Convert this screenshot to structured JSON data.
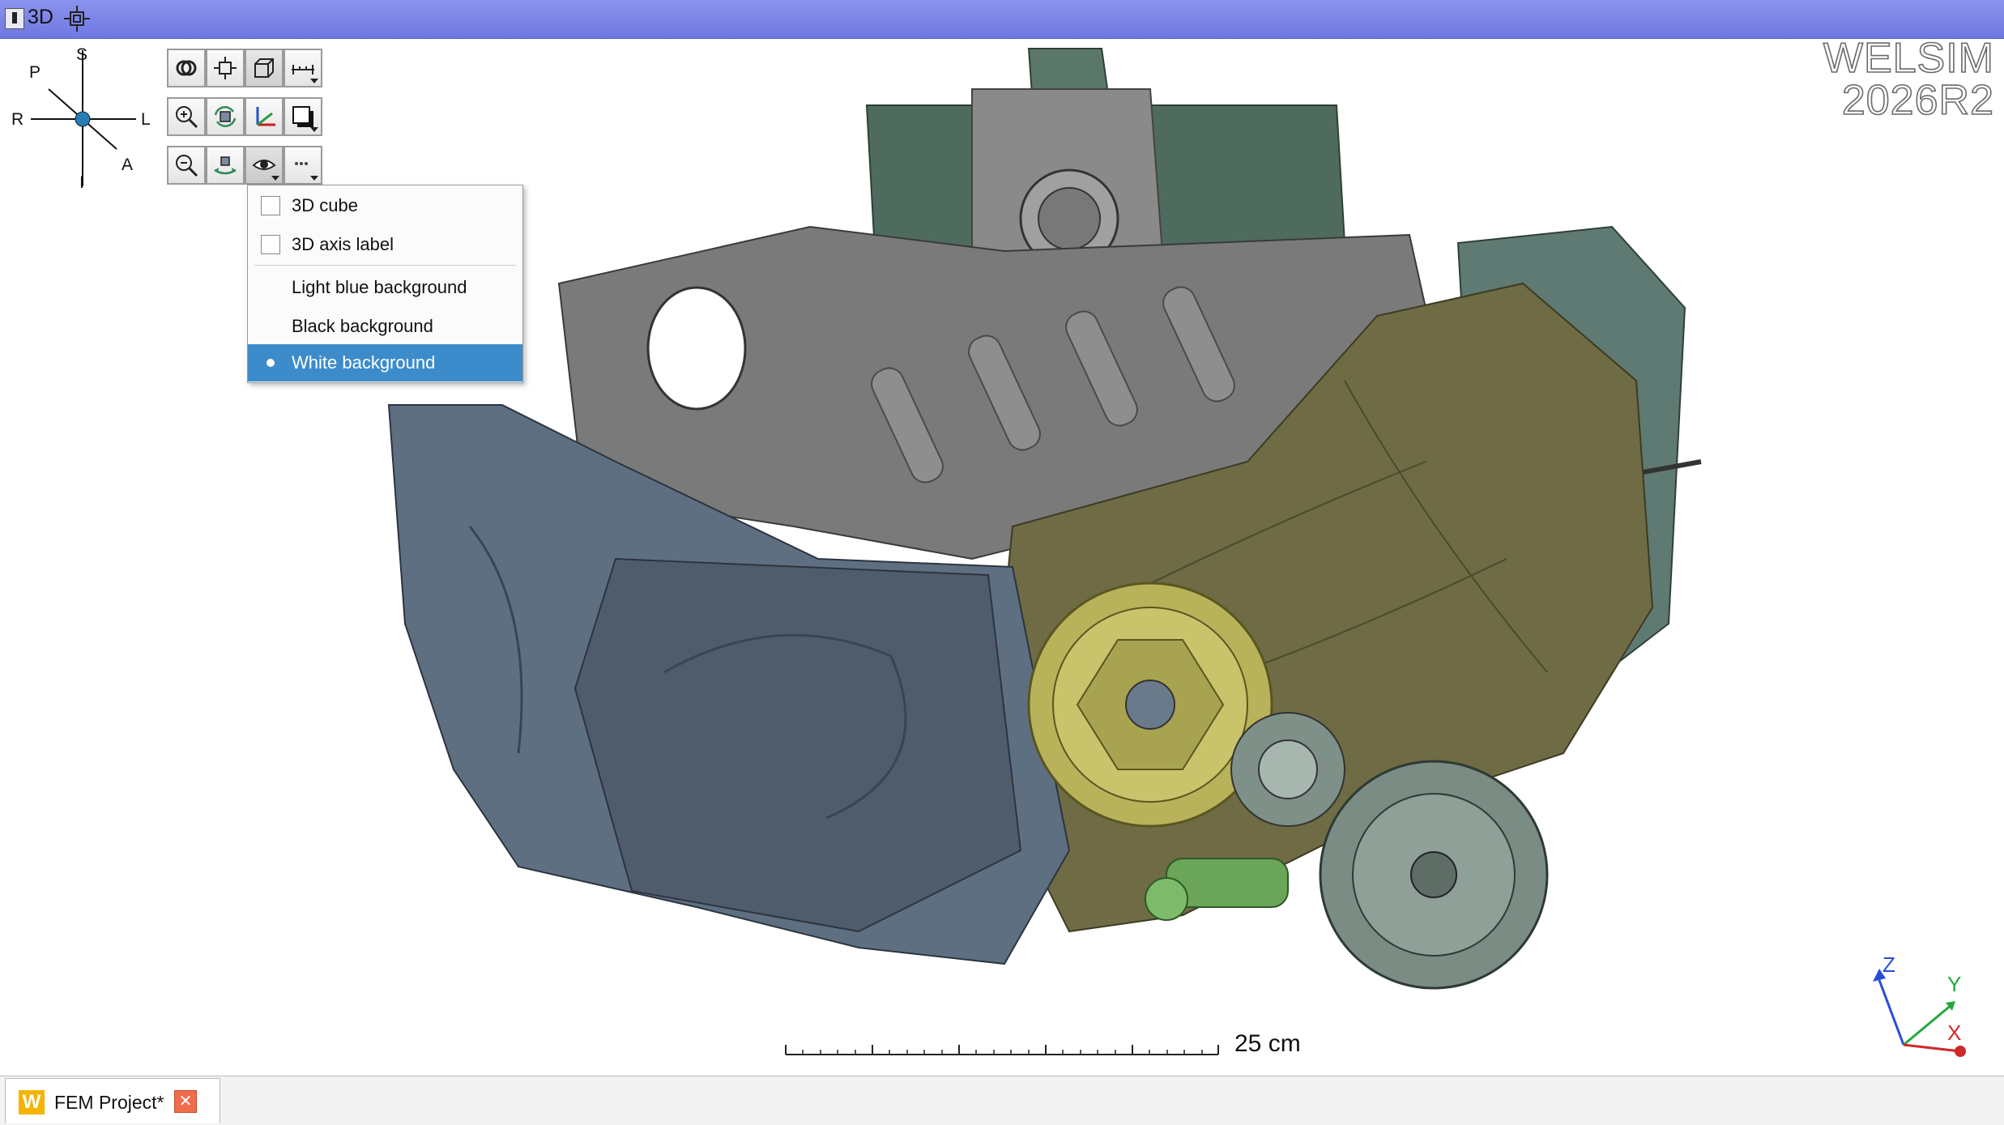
{
  "window": {
    "title": "3D"
  },
  "orientation": {
    "top": "S",
    "upper_left": "P",
    "left": "R",
    "right": "L",
    "lower_right": "A",
    "bottom": "I"
  },
  "toolbar": {
    "rows": [
      [
        "link-icon",
        "fit-view-icon",
        "cube-view-icon",
        "ruler-icon"
      ],
      [
        "zoom-in-icon",
        "rotate-view-icon",
        "axes-icon",
        "shadow-icon"
      ],
      [
        "zoom-out-icon",
        "pan-icon",
        "eye-icon",
        "more-icon"
      ]
    ]
  },
  "display_menu": {
    "items": [
      {
        "label": "3D cube",
        "type": "checkbox",
        "checked": false
      },
      {
        "label": "3D axis label",
        "type": "checkbox",
        "checked": false
      },
      {
        "label": "Light blue background",
        "type": "radio",
        "selected": false
      },
      {
        "label": "Black background",
        "type": "radio",
        "selected": false
      },
      {
        "label": "White background",
        "type": "radio",
        "selected": true
      }
    ]
  },
  "branding": {
    "line1": "WELSIM",
    "line2": "2026R2"
  },
  "scale": {
    "label": "25 cm"
  },
  "axis_triad": {
    "z": "Z",
    "y": "Y",
    "x": "X"
  },
  "tabs": [
    {
      "icon": "W",
      "label": "FEM Project*",
      "close": "✕"
    }
  ],
  "colors": {
    "titlebar": "#7b84e6",
    "menu_selected": "#3c8ccc",
    "block_gray": "#7a7a7a",
    "cover_blue": "#5f6f82",
    "cover_olive": "#6e6b45",
    "pulley_yellow": "#b8b35a",
    "top_green": "#4f6b5e",
    "tensioner_green": "#6aa55a"
  }
}
